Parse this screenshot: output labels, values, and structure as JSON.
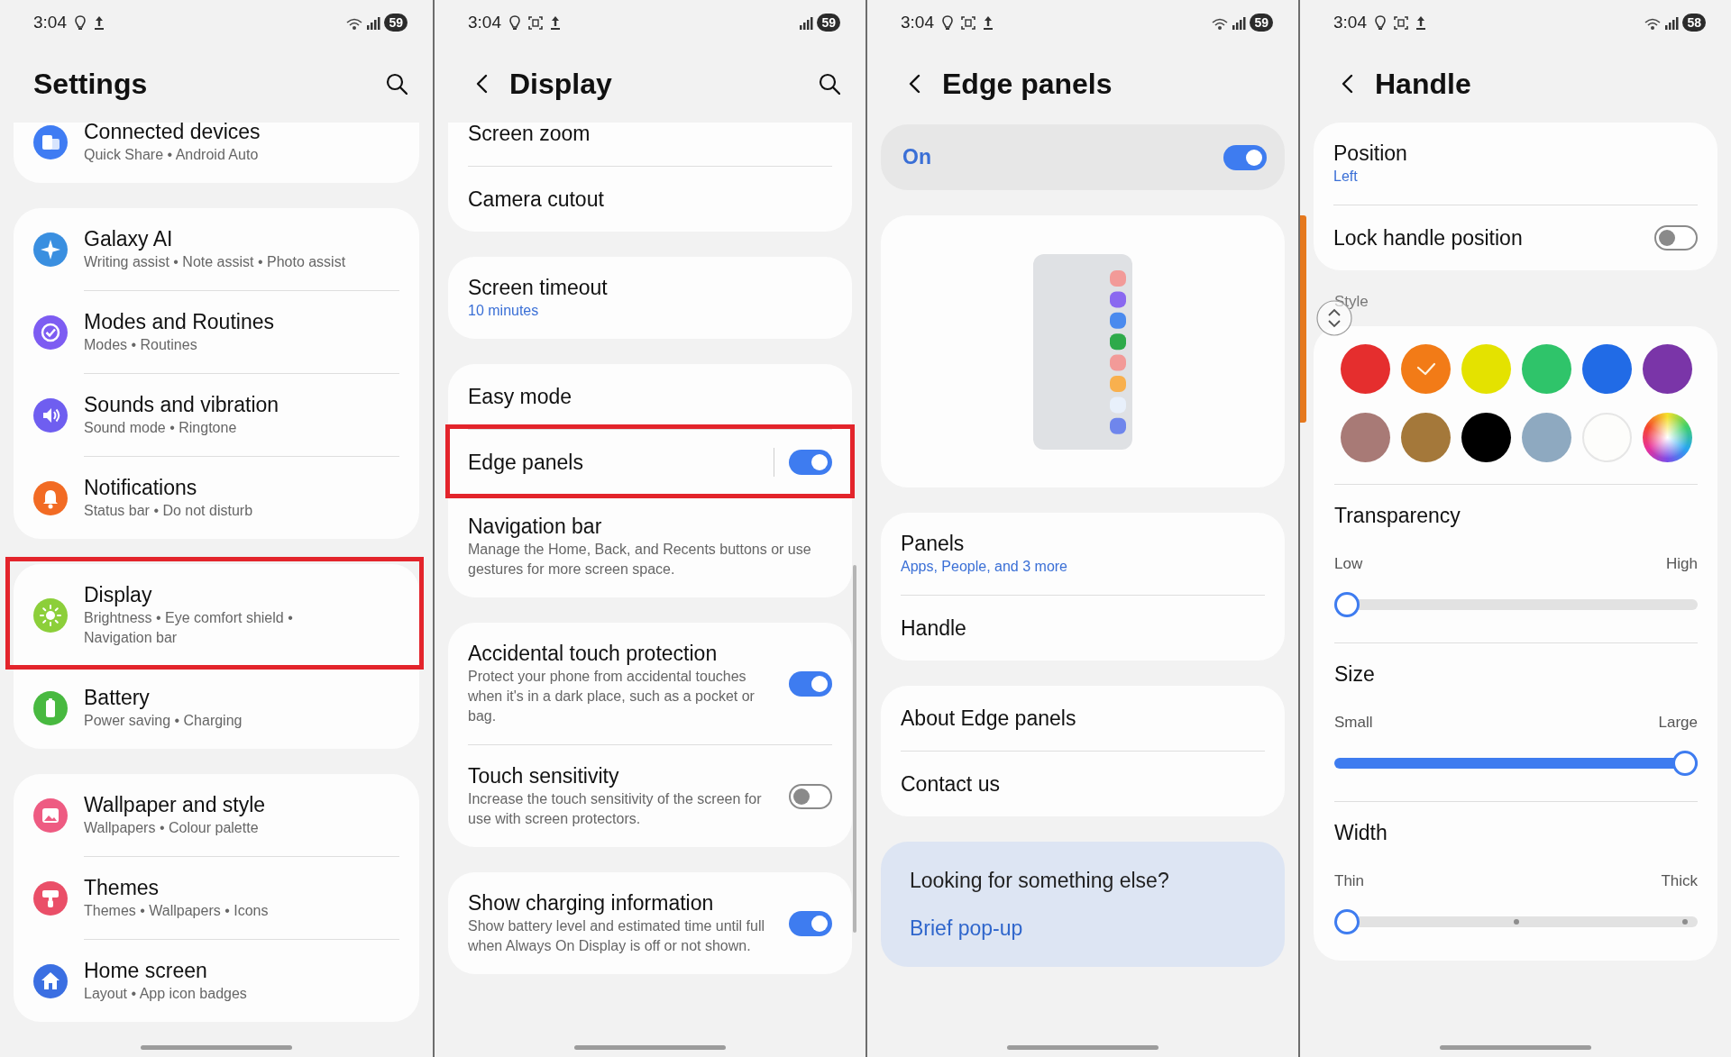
{
  "panels": [
    {
      "status_bar": {
        "time": "3:04",
        "battery": "59",
        "capture": false,
        "wifi": true
      },
      "header": {
        "title": "Settings",
        "back": false,
        "search": true
      },
      "scrollbar": false,
      "edge_handle": false,
      "blocks": [
        {
          "kind": "group",
          "clipped": true,
          "rows": [
            {
              "title": "Connected devices",
              "subtitle": "Quick Share • Android Auto",
              "kind": "plain",
              "color": "#3f7cf3",
              "highlighted": false
            }
          ]
        },
        {
          "kind": "group",
          "rows": [
            {
              "title": "Galaxy AI",
              "subtitle": "Writing assist • Note assist • Photo assist",
              "kind": "plain",
              "color": "#3a8fe0",
              "highlighted": false
            },
            {
              "title": "Modes and Routines",
              "subtitle": "Modes • Routines",
              "kind": "plain",
              "color": "#7d5cf2",
              "highlighted": false
            },
            {
              "title": "Sounds and vibration",
              "subtitle": "Sound mode • Ringtone",
              "kind": "plain",
              "color": "#6f5ef0",
              "highlighted": false
            },
            {
              "title": "Notifications",
              "subtitle": "Status bar • Do not disturb",
              "kind": "plain",
              "color": "#f26b24",
              "highlighted": false
            }
          ]
        },
        {
          "kind": "group",
          "rows": [
            {
              "title": "Display",
              "subtitle": "Brightness • Eye comfort shield • Navigation bar",
              "kind": "plain",
              "color": "#8ccf3a",
              "highlighted": true
            },
            {
              "title": "Battery",
              "subtitle": "Power saving • Charging",
              "kind": "plain",
              "color": "#48b940",
              "highlighted": false
            }
          ]
        },
        {
          "kind": "group",
          "rows": [
            {
              "title": "Wallpaper and style",
              "subtitle": "Wallpapers • Colour palette",
              "kind": "plain",
              "color": "#ee5b82",
              "highlighted": false
            },
            {
              "title": "Themes",
              "subtitle": "Themes • Wallpapers • Icons",
              "kind": "plain",
              "color": "#ea4f68",
              "highlighted": false
            },
            {
              "title": "Home screen",
              "subtitle": "Layout • App icon badges",
              "kind": "plain",
              "color": "#3b6fe2",
              "highlighted": false
            }
          ]
        }
      ]
    },
    {
      "status_bar": {
        "time": "3:04",
        "battery": "59",
        "capture": true,
        "wifi": false
      },
      "header": {
        "title": "Display",
        "back": true,
        "search": true
      },
      "scrollbar": true,
      "edge_handle": false,
      "blocks": [
        {
          "kind": "group",
          "clipped": true,
          "rows": [
            {
              "title": "Screen zoom",
              "highlighted": false
            },
            {
              "title": "Camera cutout",
              "highlighted": false
            }
          ]
        },
        {
          "kind": "group",
          "rows": [
            {
              "title": "Screen timeout",
              "subtitle": "10 minutes",
              "kind": "value",
              "highlighted": false
            }
          ]
        },
        {
          "kind": "group",
          "rows": [
            {
              "title": "Easy mode",
              "highlighted": false
            },
            {
              "title": "Edge panels",
              "on": true,
              "switch_divider": true,
              "highlighted": true
            },
            {
              "title": "Navigation bar",
              "subtitle": "Manage the Home, Back, and Recents buttons or use gestures for more screen space.",
              "kind": "description",
              "highlighted": false
            }
          ]
        },
        {
          "kind": "group",
          "rows": [
            {
              "title": "Accidental touch protection",
              "subtitle": "Protect your phone from accidental touches when it's in a dark place, such as a pocket or bag.",
              "kind": "description",
              "on": true,
              "highlighted": false
            },
            {
              "title": "Touch sensitivity",
              "subtitle": "Increase the touch sensitivity of the screen for use with screen protectors.",
              "kind": "description",
              "on": false,
              "highlighted": false
            }
          ]
        },
        {
          "kind": "group",
          "rows": [
            {
              "title": "Show charging information",
              "subtitle": "Show battery level and estimated time until full when Always On Display is off or not shown.",
              "kind": "description",
              "on": true,
              "highlighted": false
            }
          ]
        }
      ]
    },
    {
      "status_bar": {
        "time": "3:04",
        "battery": "59",
        "capture": true,
        "wifi": true
      },
      "header": {
        "title": "Edge panels",
        "back": true,
        "search": false
      },
      "scrollbar": false,
      "edge_handle": false,
      "blocks": [
        {
          "kind": "master_switch",
          "label": "On",
          "on": true
        },
        {
          "kind": "preview"
        },
        {
          "kind": "group",
          "rows": [
            {
              "title": "Panels",
              "subtitle": "Apps, People, and 3 more",
              "kind": "value",
              "highlighted": false
            },
            {
              "title": "Handle",
              "highlighted": false
            }
          ]
        },
        {
          "kind": "group",
          "rows": [
            {
              "title": "About Edge panels",
              "highlighted": false
            },
            {
              "title": "Contact us",
              "highlighted": false
            }
          ]
        },
        {
          "kind": "suggestion",
          "title": "Looking for something else?",
          "links": [
            "Brief pop-up"
          ]
        }
      ]
    },
    {
      "status_bar": {
        "time": "3:04",
        "battery": "58",
        "capture": true,
        "wifi": true
      },
      "header": {
        "title": "Handle",
        "back": true,
        "search": false
      },
      "scrollbar": false,
      "edge_handle": true,
      "blocks": [
        {
          "kind": "group",
          "rows": [
            {
              "title": "Position",
              "subtitle": "Left",
              "kind": "value",
              "highlighted": false
            },
            {
              "title": "Lock handle position",
              "on": false,
              "highlighted": false
            }
          ]
        },
        {
          "kind": "label",
          "text": "Style"
        },
        {
          "kind": "style_card",
          "swatches": [
            {
              "kind": "solid",
              "color": "#e52e2e",
              "selected": false
            },
            {
              "kind": "solid",
              "color": "#f27b17",
              "selected": true
            },
            {
              "kind": "solid",
              "color": "#e4e200",
              "selected": false
            },
            {
              "kind": "solid",
              "color": "#2fc46a",
              "selected": false
            },
            {
              "kind": "solid",
              "color": "#216be6",
              "selected": false
            },
            {
              "kind": "solid",
              "color": "#7a35a8",
              "selected": false
            },
            {
              "kind": "solid",
              "color": "#a87a76",
              "selected": false
            },
            {
              "kind": "solid",
              "color": "#a4783a",
              "selected": false
            },
            {
              "kind": "solid",
              "color": "#000000",
              "selected": false
            },
            {
              "kind": "solid",
              "color": "#8ea9c0",
              "selected": false
            },
            {
              "kind": "solid",
              "color": "#fdfdfb",
              "selected": false
            },
            {
              "kind": "wheel",
              "selected": false
            }
          ],
          "sliders": [
            {
              "title": "Transparency",
              "min_label": "Low",
              "max_label": "High",
              "level": 0,
              "kind": "continuous"
            },
            {
              "title": "Size",
              "min_label": "Small",
              "max_label": "Large",
              "level": 1,
              "kind": "continuous"
            },
            {
              "title": "Width",
              "min_label": "Thin",
              "max_label": "Thick",
              "level": 0,
              "kind": "stepped"
            }
          ]
        }
      ]
    }
  ]
}
